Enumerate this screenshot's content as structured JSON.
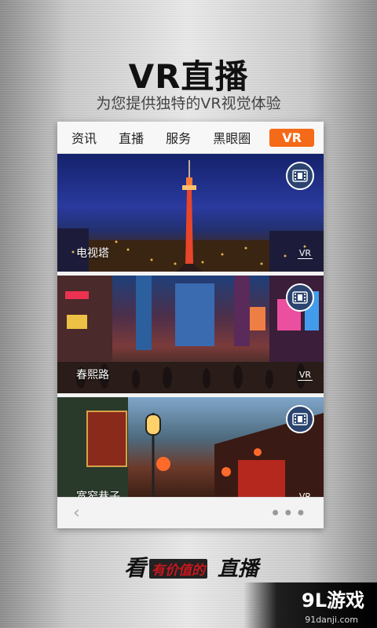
{
  "header": {
    "title": "VR直播",
    "subtitle": "为您提供独特的VR视觉体验"
  },
  "tabs": [
    {
      "label": "资讯",
      "active": false
    },
    {
      "label": "直播",
      "active": false
    },
    {
      "label": "服务",
      "active": false
    },
    {
      "label": "黑眼圈",
      "active": false
    },
    {
      "label": "VR",
      "active": true
    }
  ],
  "cards": [
    {
      "title": "电视塔",
      "badge": "VR",
      "icon": "film-icon"
    },
    {
      "title": "春熙路",
      "badge": "VR",
      "icon": "film-icon"
    },
    {
      "title": "宽窄巷子",
      "badge": "VR",
      "icon": "film-icon"
    }
  ],
  "bottom_bar": {
    "back_icon": "chevron-left-icon",
    "more_icon": "more-dots-icon"
  },
  "slogan": {
    "part1": "看",
    "part2": "有价值的",
    "part3": "直播"
  },
  "watermark": {
    "main": "9L游戏",
    "sub": "91danji.com"
  },
  "colors": {
    "accent": "#f56a19",
    "badge_bg": "#2b4470"
  }
}
